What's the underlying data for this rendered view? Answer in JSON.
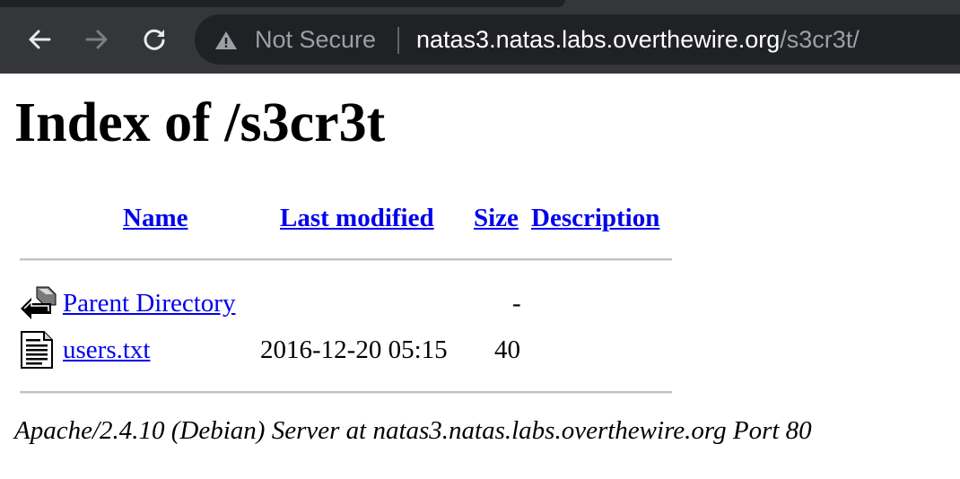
{
  "browser": {
    "security_label": "Not Secure",
    "url_host": "natas3.natas.labs.overthewire.org",
    "url_path": "/s3cr3t/",
    "icons": {
      "back": "arrow-left-icon",
      "forward": "arrow-right-icon",
      "reload": "reload-icon",
      "security": "warning-triangle-icon"
    }
  },
  "page": {
    "title": "Index of /s3cr3t",
    "columns": {
      "name": "Name",
      "modified": "Last modified",
      "size": "Size",
      "description": "Description"
    },
    "rows": [
      {
        "icon": "back-arrow-icon",
        "name": "Parent Directory",
        "modified": "",
        "size": "-",
        "description": ""
      },
      {
        "icon": "text-file-icon",
        "name": "users.txt",
        "modified": "2016-12-20 05:15",
        "size": "40",
        "description": ""
      }
    ],
    "footer": "Apache/2.4.10 (Debian) Server at natas3.natas.labs.overthewire.org Port 80"
  }
}
